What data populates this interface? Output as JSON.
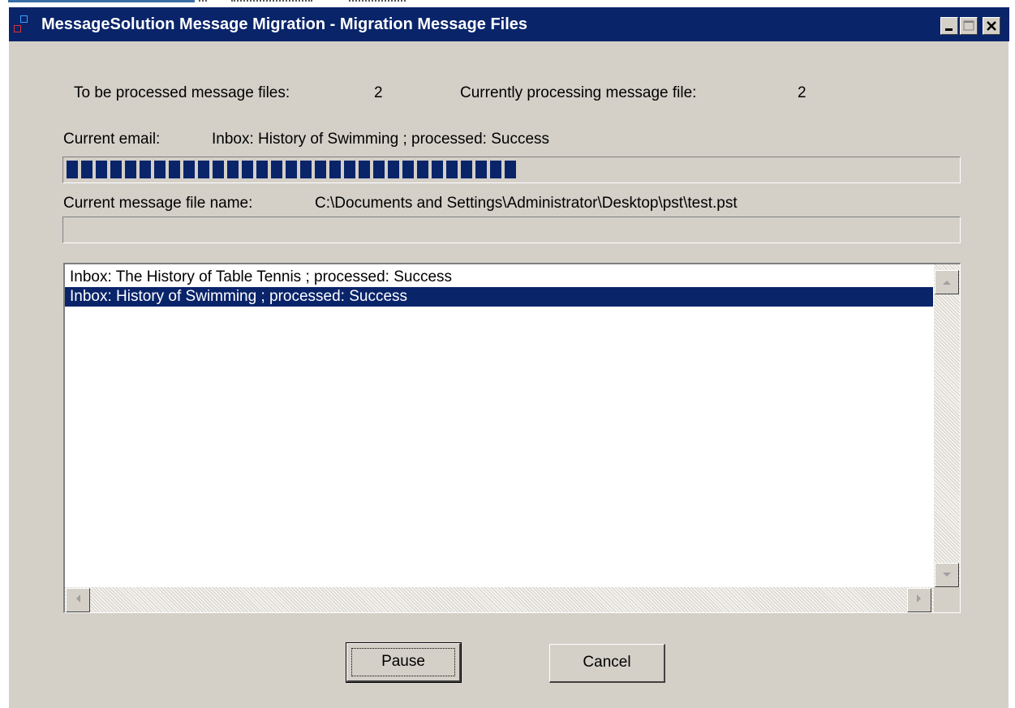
{
  "window": {
    "title": "MessageSolution Message Migration - Migration Message Files",
    "controls": [
      "minimize-icon",
      "maximize-icon",
      "close-icon"
    ],
    "accent_color": "#0a246a",
    "face_color": "#d4d0c8"
  },
  "status": {
    "to_be_processed_label": "To be processed message files:",
    "to_be_processed_value": "2",
    "currently_processing_label": "Currently processing message file:",
    "currently_processing_value": "2",
    "current_email_label": "Current email:",
    "current_email_value": "Inbox:  History of Swimming ; processed: Success",
    "email_progress_fraction": 0.51,
    "file_name_label": "Current message file name:",
    "file_name_value": "C:\\Documents and Settings\\Administrator\\Desktop\\pst\\test.pst",
    "file_progress_fraction": 0
  },
  "log": {
    "items": [
      "Inbox:  The History of Table Tennis ; processed: Success",
      "Inbox:  History of Swimming ; processed: Success"
    ],
    "selected_index": 1
  },
  "buttons": {
    "pause_label": "Pause",
    "cancel_label": "Cancel"
  }
}
